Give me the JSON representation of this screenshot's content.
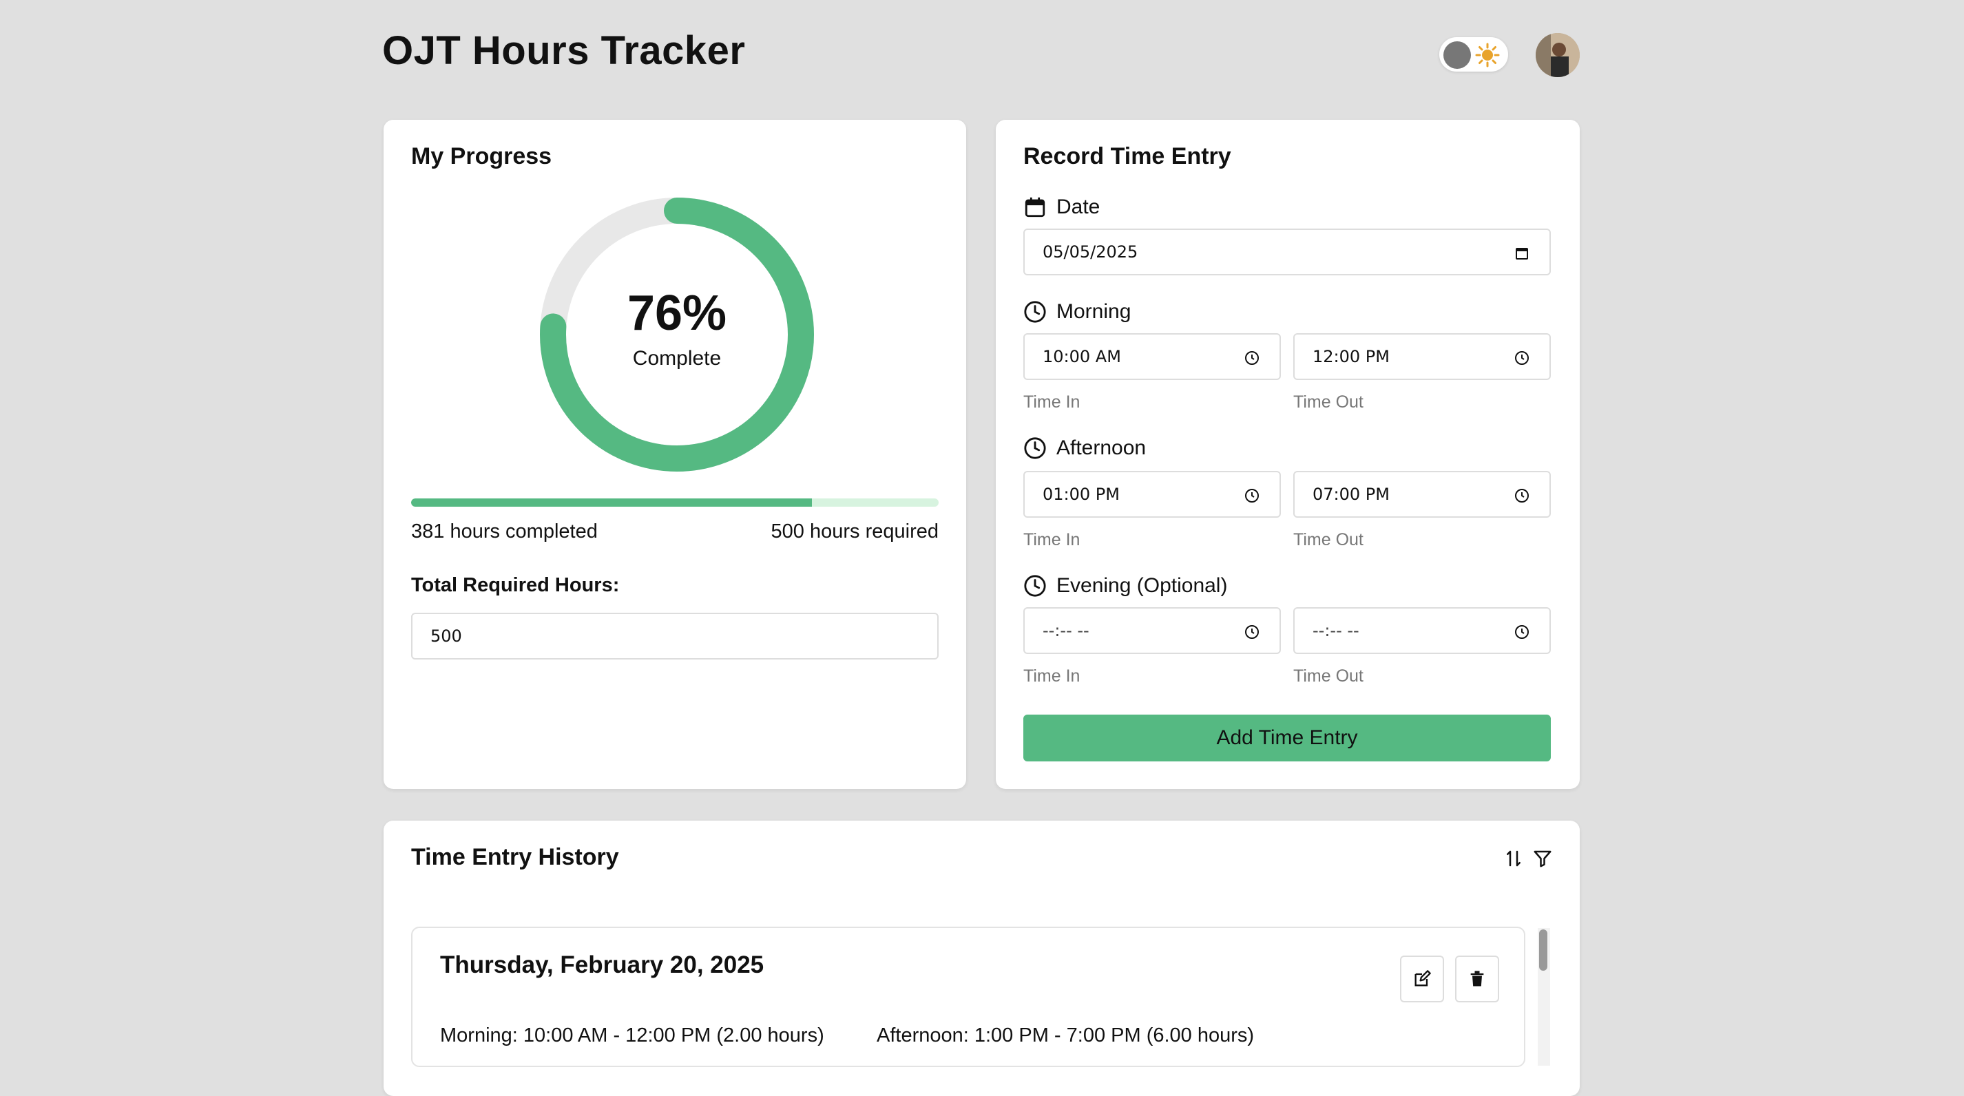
{
  "app": {
    "title": "OJT Hours Tracker",
    "avatar_name": "user-avatar",
    "accent": "#55b982"
  },
  "progress": {
    "title": "My Progress",
    "percent_label": "76%",
    "percent_value": 0.76,
    "complete_label": "Complete",
    "completed_text": "381 hours completed",
    "required_text": "500 hours required",
    "total_label": "Total Required Hours:",
    "total_value": "500"
  },
  "record": {
    "title": "Record Time Entry",
    "date_label": "Date",
    "date_value": "05/05/2025",
    "morning_label": "Morning",
    "morning_in": "10:00 AM",
    "morning_out": "12:00 PM",
    "afternoon_label": "Afternoon",
    "afternoon_in": "01:00 PM",
    "afternoon_out": "07:00 PM",
    "evening_label": "Evening (Optional)",
    "evening_in": "--:-- --",
    "evening_out": "--:-- --",
    "time_in_hint": "Time In",
    "time_out_hint": "Time Out",
    "add_button": "Add Time Entry"
  },
  "history": {
    "title": "Time Entry History",
    "entries": [
      {
        "date": "Thursday, February 20, 2025",
        "morning": "Morning: 10:00 AM - 12:00 PM (2.00 hours)",
        "afternoon": "Afternoon: 1:00 PM - 7:00 PM (6.00 hours)"
      }
    ]
  }
}
